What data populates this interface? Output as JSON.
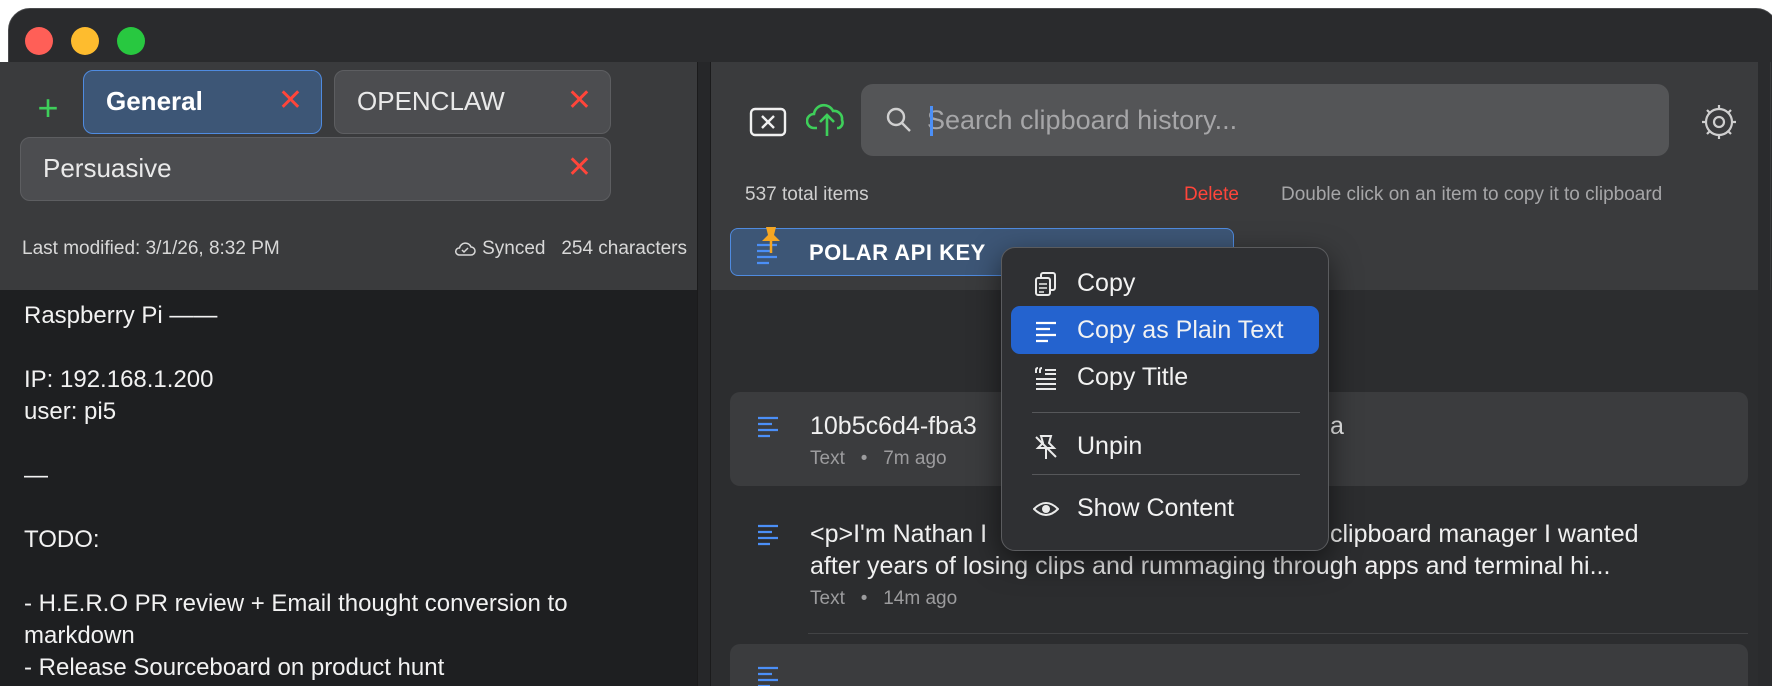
{
  "left": {
    "add_tab_glyph": "+",
    "tabs": [
      {
        "label": "General",
        "active": true
      },
      {
        "label": "OPENCLAW",
        "active": false
      },
      {
        "label": "Persuasive",
        "active": false
      }
    ],
    "close_glyph": "✕",
    "last_modified": "Last modified: 3/1/26, 8:32 PM",
    "sync_status": "Synced",
    "char_count": "254 characters",
    "note_text": "Raspberry Pi ——\n\nIP: 192.168.1.200\nuser: pi5\n\n—\n\nTODO:\n\n- H.E.R.O PR review + Email thought conversion to\nmarkdown\n- Release Sourceboard on product hunt"
  },
  "right": {
    "search_placeholder": "Search clipboard history...",
    "total_items": "537 total items",
    "delete_label": "Delete",
    "hint": "Double click on an item to copy it to clipboard",
    "pinned_title": "POLAR API KEY",
    "items": [
      {
        "text": "10b5c6d4-fba3",
        "text_tail": "a",
        "type": "Text",
        "time": "7m ago",
        "dot": "•"
      },
      {
        "text": "<p>I'm Nathan I",
        "text_tail": "clipboard manager I wanted",
        "text2": "after years of losing clips and rummaging through apps and terminal hi...",
        "type": "Text",
        "time": "14m ago",
        "dot": "•"
      }
    ]
  },
  "context_menu": {
    "items": [
      "Copy",
      "Copy as Plain Text",
      "Copy Title",
      "Unpin",
      "Show Content"
    ],
    "highlighted": "Copy as Plain Text"
  },
  "colors": {
    "accent_blue": "#2463cf",
    "add_green": "#3ecf5a",
    "close_red": "#ff453a",
    "pin_orange": "#f5a623"
  }
}
